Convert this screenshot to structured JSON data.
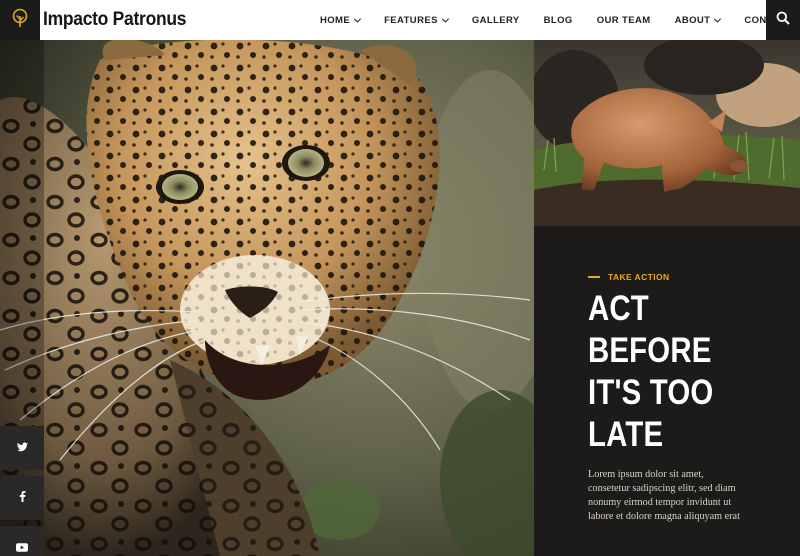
{
  "brand": {
    "name": "Impacto Patronus",
    "logo_icon": "tree-icon",
    "accent_color": "#e5a823"
  },
  "nav": {
    "items": [
      {
        "label": "HOME",
        "has_dropdown": true
      },
      {
        "label": "FEATURES",
        "has_dropdown": true
      },
      {
        "label": "GALLERY",
        "has_dropdown": false
      },
      {
        "label": "BLOG",
        "has_dropdown": false
      },
      {
        "label": "OUR TEAM",
        "has_dropdown": false
      },
      {
        "label": "ABOUT",
        "has_dropdown": true
      },
      {
        "label": "CONTACTS",
        "has_dropdown": true
      }
    ],
    "search_icon": "search-icon"
  },
  "hero": {
    "image_subject": "leopard-photo"
  },
  "secondary_image": {
    "image_subject": "pig-photo"
  },
  "cta": {
    "kicker": "TAKE ACTION",
    "headline_lines": [
      "ACT",
      "BEFORE",
      "IT'S TOO",
      "LATE"
    ],
    "body_lines": [
      "Lorem ipsum dolor sit amet,",
      "consetetur sadipscing elitr, sed diam",
      "nonumy eirmod tempor invidunt ut",
      "labore et dolore magna aliquyam erat"
    ]
  },
  "social": [
    {
      "icon": "twitter-icon",
      "glyph": "t"
    },
    {
      "icon": "facebook-icon",
      "glyph": "f"
    },
    {
      "icon": "youtube-icon",
      "glyph": "▶"
    }
  ]
}
